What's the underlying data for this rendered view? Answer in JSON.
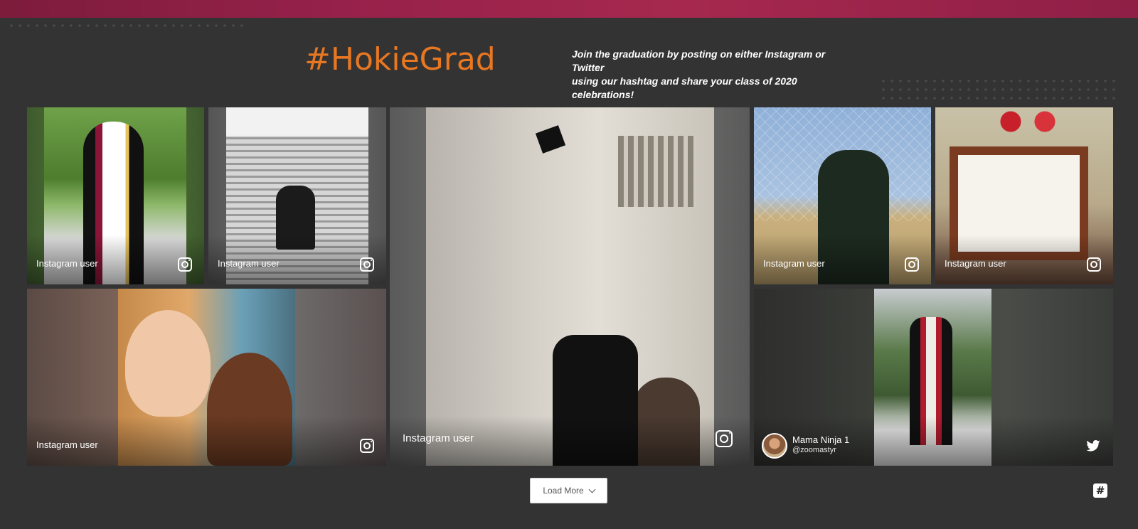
{
  "header": {
    "hashtag": "#HokieGrad",
    "tagline_line1": "Join the graduation by posting on either Instagram or Twitter",
    "tagline_line2": "using our hashtag and share your class of 2020 celebrations!"
  },
  "colors": {
    "accent": "#e87722",
    "band": "#96214a",
    "background": "#333333"
  },
  "posts": [
    {
      "user": "Instagram user",
      "network": "instagram-icon"
    },
    {
      "user": "Instagram user",
      "network": "instagram-icon"
    },
    {
      "user": "Instagram user",
      "network": "instagram-icon"
    },
    {
      "user": "Instagram user",
      "network": "instagram-icon"
    },
    {
      "user": "Instagram user",
      "network": "instagram-icon"
    },
    {
      "user": "Instagram user",
      "network": "instagram-icon"
    },
    {
      "user": "Mama Ninja 1",
      "handle": "@zoomastyr",
      "network": "twitter-icon"
    }
  ],
  "load_more": {
    "label": "Load More"
  },
  "badge": {
    "symbol": "#"
  }
}
